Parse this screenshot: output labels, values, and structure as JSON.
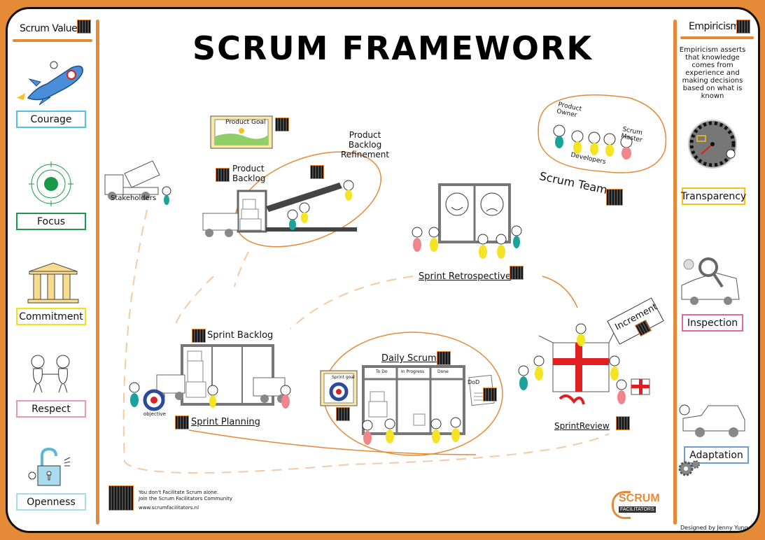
{
  "title": "SCRUM FRAMEWORK",
  "left_panel": {
    "title": "Scrum Values",
    "values": [
      {
        "label": "Courage",
        "icon": "rocket-icon",
        "color": "#4fc3e0"
      },
      {
        "label": "Focus",
        "icon": "target-icon",
        "color": "#1a9a48"
      },
      {
        "label": "Commitment",
        "icon": "temple-icon",
        "color": "#f2e01c"
      },
      {
        "label": "Respect",
        "icon": "handshake-icon",
        "color": "#e996b8"
      },
      {
        "label": "Openness",
        "icon": "open-lock-icon",
        "color": "#a9dcef"
      }
    ]
  },
  "right_panel": {
    "title": "Empiricism",
    "description": "Empiricism asserts that knowledge comes from experience and making decisions based on what is known",
    "pillars": [
      {
        "label": "Transparency",
        "icon": "gauge-icon",
        "color": "#f2c21c"
      },
      {
        "label": "Inspection",
        "icon": "magnifier-icon",
        "color": "#e8679a"
      },
      {
        "label": "Adaptation",
        "icon": "gears-icon",
        "color": "#6e9bd6"
      }
    ]
  },
  "diagram": {
    "product_goal": "Product Goal",
    "product_backlog": "Product Backlog",
    "product_backlog_line1": "Product",
    "product_backlog_line2": "Backlog",
    "refinement_line1": "Product",
    "refinement_line2": "Backlog",
    "refinement_line3": "Refinement",
    "stakeholders": "Stakeholders",
    "scrum_team": "Scrum Team",
    "product_owner_line1": "Product",
    "product_owner_line2": "Owner",
    "scrum_master_line1": "Scrum",
    "scrum_master_line2": "Master",
    "developers": "Developers",
    "sprint_retrospective": "Sprint Retrospective",
    "sprint_backlog": "Sprint Backlog",
    "sprint_planning": "Sprint Planning",
    "objective": "objective",
    "daily_scrum": "Daily Scrum",
    "board_columns": [
      "To Do",
      "In Progress",
      "Done"
    ],
    "sprint_goal": "Sprint goal",
    "dod": "DoD",
    "increment": "Increment",
    "sprint_review": "SprintReview"
  },
  "footer": {
    "community_line1": "You don't Facilitate Scrum alone.",
    "community_line2": "Join the Scrum Facilitators Community",
    "website": "www.scrumfacilitators.nl",
    "logo_line1": "SCRUM",
    "logo_line2": "FACILITATORS",
    "credit": "Designed by Jenny Yung"
  },
  "colors": {
    "accent_orange": "#e58a37",
    "border": "#111111",
    "yellow": "#f4e424",
    "teal": "#1aa39a",
    "pink": "#f0858a",
    "red": "#e02020"
  }
}
